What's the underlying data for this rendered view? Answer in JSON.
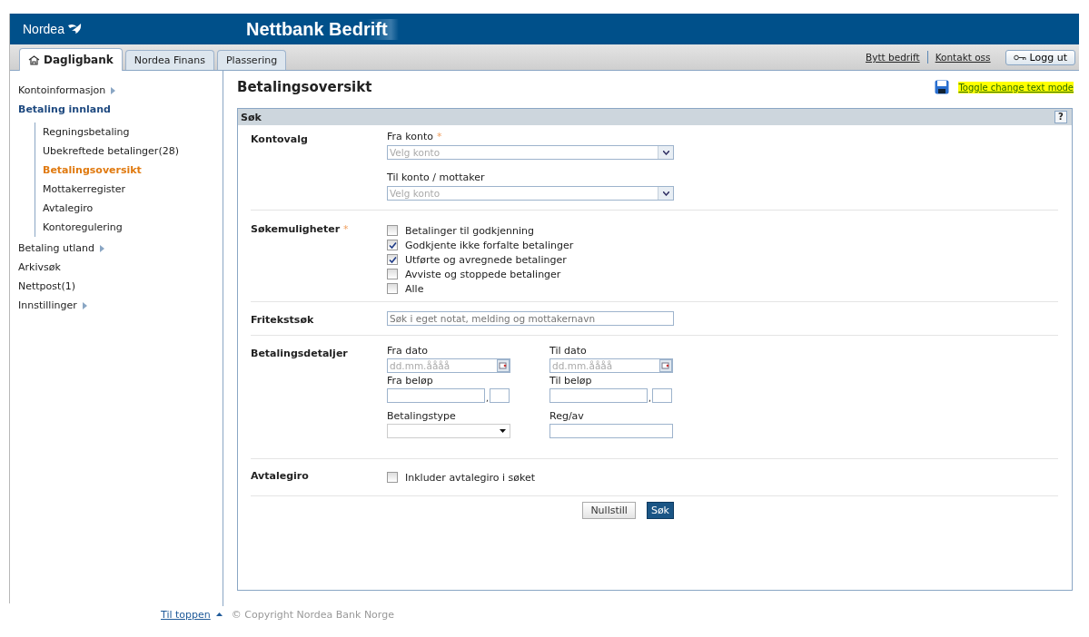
{
  "header": {
    "logo": "Nordea",
    "title": "Nettbank Bedrift"
  },
  "tabs": [
    {
      "label": "Dagligbank",
      "selected": true
    },
    {
      "label": "Nordea Finans",
      "selected": false
    },
    {
      "label": "Plassering",
      "selected": false
    }
  ],
  "top_links": [
    "Bytt bedrift",
    "Kontakt oss"
  ],
  "logout_button": "Logg ut",
  "sidebar": {
    "items": [
      {
        "label": "Kontoinformasjon",
        "expandable": true,
        "expanded": false
      },
      {
        "label": "Betaling innland",
        "expandable": false,
        "expanded": true,
        "children": [
          {
            "label": "Regningsbetaling",
            "selected": false
          },
          {
            "label": "Ubekreftede betalinger(28)",
            "selected": false
          },
          {
            "label": "Betalingsoversikt",
            "selected": true
          },
          {
            "label": "Mottakerregister",
            "selected": false
          },
          {
            "label": "Avtalegiro",
            "selected": false
          },
          {
            "label": "Kontoregulering",
            "selected": false
          }
        ]
      },
      {
        "label": "Betaling utland",
        "expandable": true,
        "expanded": false
      },
      {
        "label": "Arkivsøk",
        "expandable": false,
        "expanded": false
      },
      {
        "label": "Nettpost(1)",
        "expandable": false,
        "expanded": false
      },
      {
        "label": "Innstillinger",
        "expandable": true,
        "expanded": false
      }
    ]
  },
  "page_title": "Betalingsoversikt",
  "toggle_link": "Toggle change text mode",
  "search_panel": {
    "title": "Søk",
    "help": "?",
    "kontovalg": {
      "label": "Kontovalg",
      "from_label": "Fra konto",
      "required_mark": "*",
      "from_placeholder": "Velg konto",
      "to_label": "Til konto / mottaker",
      "to_placeholder": "Velg konto"
    },
    "search_options": {
      "label": "Søkemuligheter",
      "required_mark": "*",
      "options": [
        {
          "label": "Betalinger til godkjenning",
          "checked": false
        },
        {
          "label": "Godkjente ikke forfalte betalinger",
          "checked": true
        },
        {
          "label": "Utførte og avregnede betalinger",
          "checked": true
        },
        {
          "label": "Avviste og stoppede betalinger",
          "checked": false
        },
        {
          "label": "Alle",
          "checked": false
        }
      ]
    },
    "free_text": {
      "label": "Fritekstsøk",
      "placeholder": "Søk i eget notat, melding og mottakernavn"
    },
    "details": {
      "label": "Betalingsdetaljer",
      "from_date": {
        "label": "Fra dato",
        "placeholder": "dd.mm.åååå"
      },
      "to_date": {
        "label": "Til dato",
        "placeholder": "dd.mm.åååå"
      },
      "from_amount": {
        "label": "Fra beløp",
        "separator": ","
      },
      "to_amount": {
        "label": "Til beløp",
        "separator": ","
      },
      "payment_type": {
        "label": "Betalingstype"
      },
      "reg_by": {
        "label": "Reg/av"
      }
    },
    "avtalegiro": {
      "label": "Avtalegiro",
      "option": {
        "label": "Inkluder avtalegiro i søket",
        "checked": false
      }
    },
    "buttons": [
      "Nullstill",
      "Søk"
    ]
  },
  "footer": {
    "top_link": "Til toppen",
    "copyright": "© Copyright Nordea Bank Norge"
  }
}
